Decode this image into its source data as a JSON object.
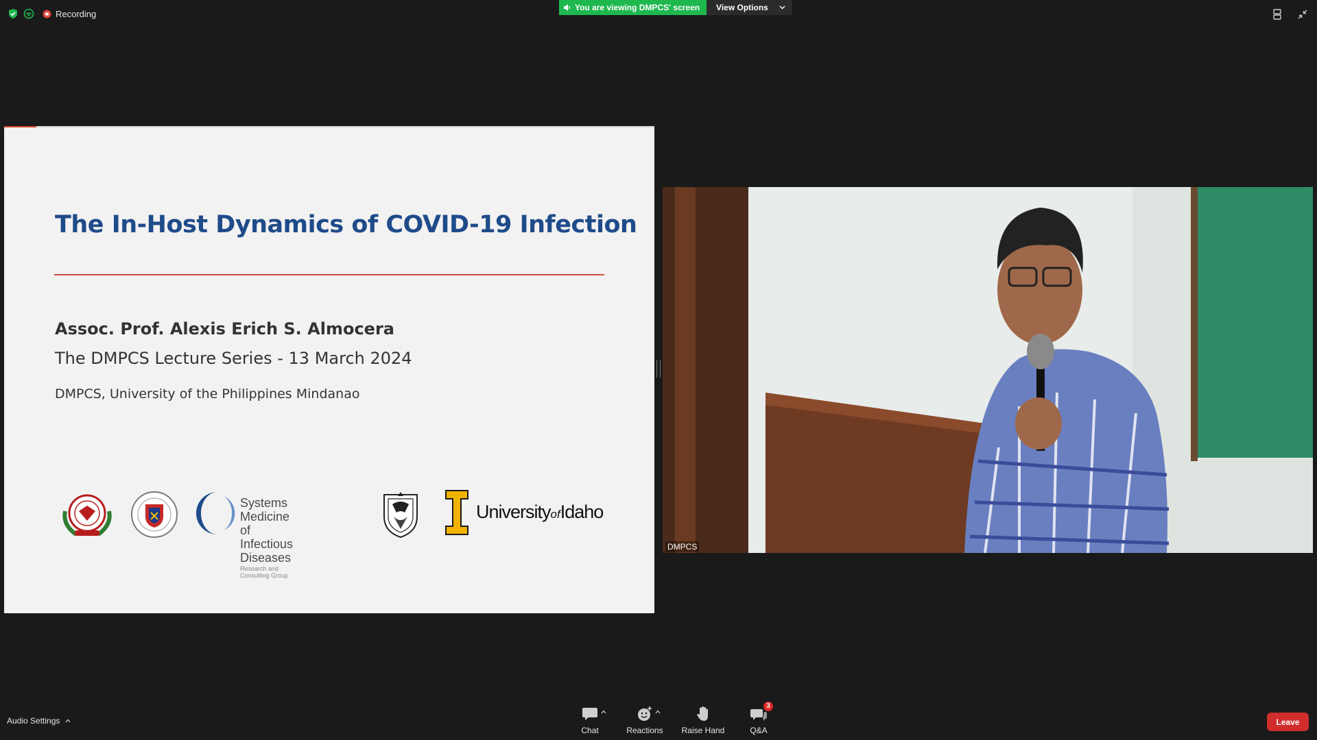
{
  "topbar": {
    "recording_label": "Recording",
    "share_banner": "You are viewing DMPCS' screen",
    "view_options_label": "View Options",
    "colors": {
      "shield": "#1fb84f",
      "recording_dot": "#e0453a",
      "banner": "#1fb84f"
    }
  },
  "slide": {
    "title": "The In-Host Dynamics of COVID-19 Infection",
    "author": "Assoc. Prof. Alexis Erich S. Almocera",
    "series": "The DMPCS Lecture Series - 13 March 2024",
    "affiliation": "DMPCS, University of the Philippines Mindanao",
    "logos": {
      "smid_line1": "Systems Medicine",
      "smid_line2": "of Infectious Diseases",
      "smid_line3": "Research and Consulting Group",
      "uidaho_university": "University",
      "uidaho_of": "of",
      "uidaho_idaho": "Idaho"
    },
    "progress": 0.05,
    "colors": {
      "title": "#1f4b8a",
      "rule": "#c9513b",
      "background": "#f2f2f2"
    }
  },
  "video": {
    "participant_name": "DMPCS"
  },
  "bottombar": {
    "audio_settings_label": "Audio Settings",
    "chat_label": "Chat",
    "reactions_label": "Reactions",
    "raise_hand_label": "Raise Hand",
    "qa_label": "Q&A",
    "qa_badge": "3",
    "leave_label": "Leave",
    "colors": {
      "leave": "#d22d2d",
      "badge": "#e02828"
    }
  }
}
